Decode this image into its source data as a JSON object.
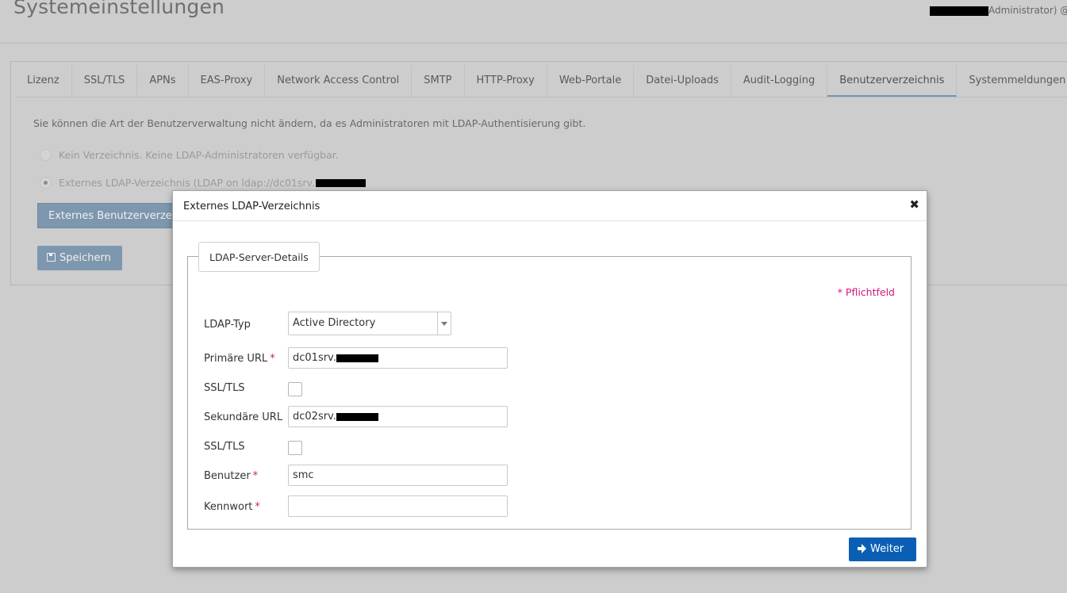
{
  "page": {
    "title": "Systemeinstellungen",
    "user_suffix": "Administrator) @"
  },
  "tabs": [
    {
      "label": "Lizenz"
    },
    {
      "label": "SSL/TLS"
    },
    {
      "label": "APNs"
    },
    {
      "label": "EAS-Proxy"
    },
    {
      "label": "Network Access Control"
    },
    {
      "label": "SMTP"
    },
    {
      "label": "HTTP-Proxy"
    },
    {
      "label": "Web-Portale"
    },
    {
      "label": "Datei-Uploads"
    },
    {
      "label": "Audit-Logging"
    },
    {
      "label": "Benutzerverzeichnis",
      "active": true
    },
    {
      "label": "Systemmeldungen"
    }
  ],
  "directory": {
    "info": "Sie können die Art der Benutzerverwaltung nicht ändern, da es Administratoren mit LDAP-Authentisierung gibt.",
    "option_none": "Kein Verzeichnis. Keine LDAP-Administratoren verfügbar.",
    "option_ldap": "Externes LDAP-Verzeichnis (LDAP on ldap://dc01srv.",
    "ext_button": "Externes Benutzerverzeichnis",
    "save_button": "Speichern"
  },
  "modal": {
    "title": "Externes LDAP-Verzeichnis",
    "legend": "LDAP-Server-Details",
    "required_note": "* Pflichtfeld",
    "labels": {
      "ldap_type": "LDAP-Typ",
      "primary_url": "Primäre URL",
      "ssl1": "SSL/TLS",
      "secondary_url": "Sekundäre URL",
      "ssl2": "SSL/TLS",
      "user": "Benutzer",
      "password": "Kennwort"
    },
    "star": "*",
    "values": {
      "ldap_type": "Active Directory",
      "primary_url": "dc01srv.",
      "secondary_url": "dc02srv.",
      "user": "smc",
      "password": ""
    },
    "next_button": "Weiter"
  }
}
